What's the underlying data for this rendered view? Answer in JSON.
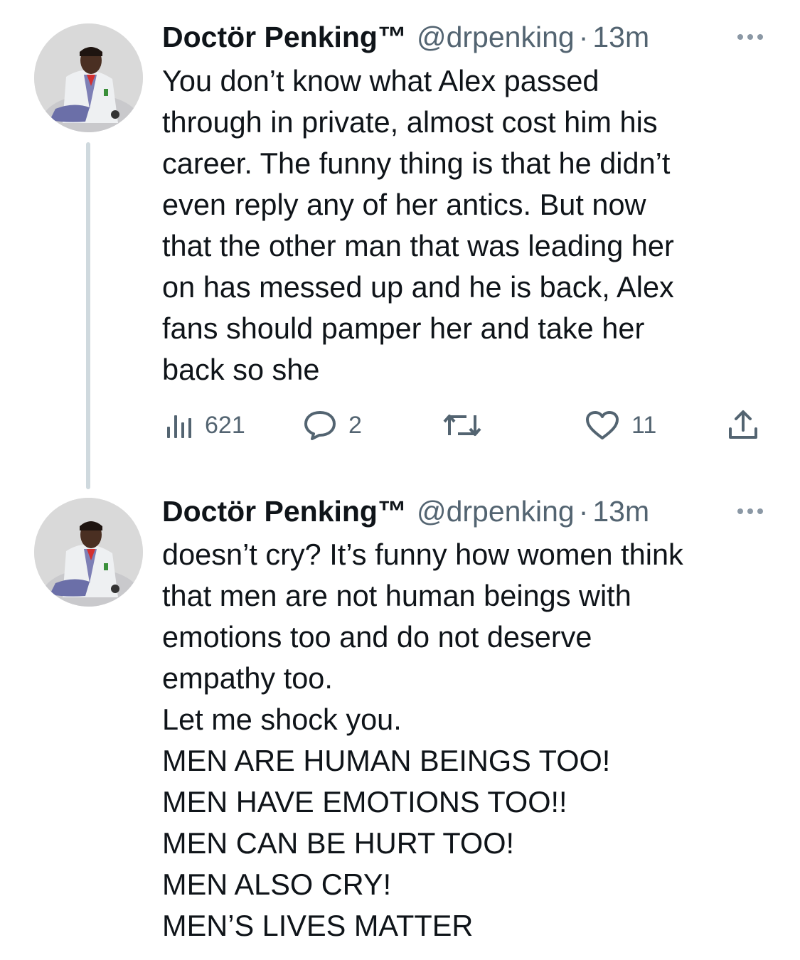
{
  "tweets": [
    {
      "author": {
        "name": "Doctör Penking™",
        "handle": "@drpenking",
        "separator": "·",
        "time": "13m"
      },
      "lines": [
        "You don’t know what Alex passed",
        "through in private, almost cost him his",
        "career. The funny thing is that he didn’t",
        "even reply any of her antics. But now",
        "that the other man that was leading her",
        "on has messed up and he is back, Alex",
        "fans should pamper her and take her",
        "back so she"
      ],
      "stats": {
        "views": "621",
        "replies": "2",
        "retweets": "",
        "likes": "11"
      }
    },
    {
      "author": {
        "name": "Doctör Penking™",
        "handle": "@drpenking",
        "separator": "·",
        "time": "13m"
      },
      "lines": [
        "doesn’t cry? It’s funny how women think",
        "that men are not human beings with",
        "emotions too and do not deserve",
        "empathy too.",
        "Let me shock you.",
        "MEN ARE HUMAN BEINGS TOO!",
        "MEN HAVE EMOTIONS TOO!!",
        "MEN CAN BE HURT TOO!",
        "MEN ALSO CRY!",
        "MEN’S LIVES MATTER"
      ]
    }
  ],
  "icons": {
    "views": "bar-chart-icon",
    "reply": "speech-bubble-icon",
    "retweet": "retweet-arrows-icon",
    "like": "heart-icon",
    "share": "share-upload-icon",
    "more": "more-dots-icon"
  },
  "colors": {
    "text": "#0f1419",
    "secondary": "#536471",
    "thread_line": "#cfd9de"
  }
}
